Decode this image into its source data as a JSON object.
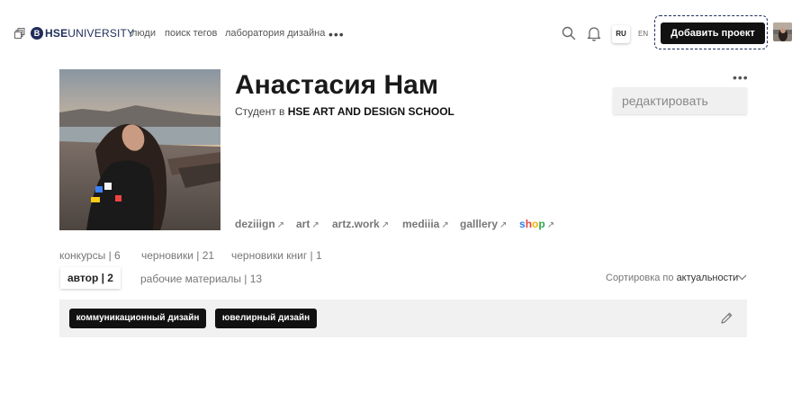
{
  "header": {
    "logo_em": "В",
    "logo_bold": "HSE",
    "logo_rest": "UNIVERSITY",
    "nav": [
      "люди",
      "поиск тегов",
      "лаборатория дизайна"
    ],
    "nav_more": "•••",
    "lang_active": "RU",
    "lang_other": "EN",
    "add_project_label": "Добавить проект"
  },
  "profile": {
    "name": "Анастасия Нам",
    "status_prefix": "Студент в ",
    "school": "HSE ART AND DESIGN SCHOOL",
    "more": "•••",
    "edit_label": "редактировать",
    "links": [
      "deziiign",
      "art",
      "artz.work",
      "mediiia",
      "galllery"
    ],
    "shop_letters": [
      "s",
      "h",
      "o",
      "p"
    ],
    "shop_colors": [
      "#2f80ed",
      "#e8453c",
      "#f4b400",
      "#2fa84f"
    ],
    "link_arrow": "↗"
  },
  "tabs": {
    "row1": [
      "конкурсы | 6",
      "черновики | 21",
      "черновики книг | 1"
    ],
    "active": "автор | 2",
    "row2_other": "рабочие материалы | 13"
  },
  "sort": {
    "label": "Сортировка по ",
    "value": "актуальности"
  },
  "tags": [
    "коммуникационный дизайн",
    "ювелирный дизайн"
  ],
  "icons": {
    "logo": "logo-squares-icon",
    "search": "search-icon",
    "bell": "bell-icon",
    "chevron": "chevron-down-icon",
    "pencil": "pencil-icon"
  }
}
